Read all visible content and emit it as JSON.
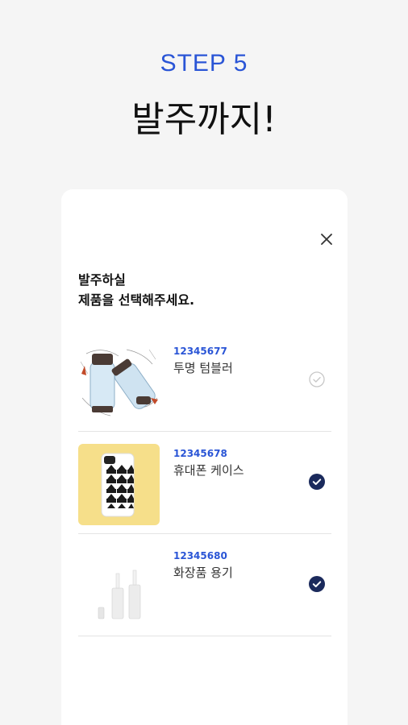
{
  "header": {
    "step": "STEP 5",
    "title": "발주까지!"
  },
  "card": {
    "prompt_line1": "발주하실",
    "prompt_line2": "제품을 선택해주세요.",
    "items": [
      {
        "code": "12345677",
        "name": "투명 텀블러",
        "selected": false,
        "image": "tumbler-image"
      },
      {
        "code": "12345678",
        "name": "휴대폰 케이스",
        "selected": true,
        "image": "phone-case-image"
      },
      {
        "code": "12345680",
        "name": "화장품 용기",
        "selected": true,
        "image": "cosmetic-container-image"
      }
    ]
  },
  "colors": {
    "accent": "#2a55d6",
    "check_selected": "#1b2a5c",
    "check_unselected": "#c8c8c8",
    "background": "#f5f5f5"
  }
}
